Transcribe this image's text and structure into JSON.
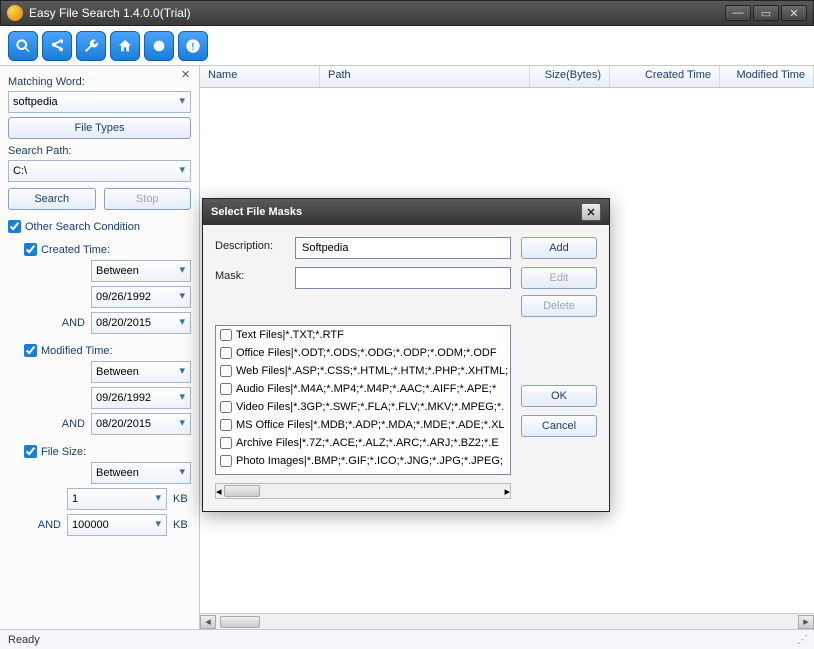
{
  "window": {
    "title": "Easy File Search 1.4.0.0(Trial)"
  },
  "toolbar_icons": [
    "search",
    "share",
    "wrench",
    "home",
    "timer",
    "alert"
  ],
  "sidebar": {
    "matching_label": "Matching Word:",
    "matching_value": "softpedia",
    "file_types_btn": "File Types",
    "search_path_label": "Search Path:",
    "search_path_value": "C:\\",
    "search_btn": "Search",
    "stop_btn": "Stop",
    "other_cond": "Other Search Condition",
    "created": {
      "label": "Created Time:",
      "mode": "Between",
      "from": "09/26/1992",
      "and": "AND",
      "to": "08/20/2015"
    },
    "modified": {
      "label": "Modified Time:",
      "mode": "Between",
      "from": "09/26/1992",
      "and": "AND",
      "to": "08/20/2015"
    },
    "size": {
      "label": "File Size:",
      "mode": "Between",
      "from": "1",
      "and": "AND",
      "to": "100000",
      "unit": "KB"
    }
  },
  "columns": [
    "Name",
    "Path",
    "Size(Bytes)",
    "Created Time",
    "Modified Time"
  ],
  "status": "Ready",
  "modal": {
    "title": "Select File Masks",
    "desc_label": "Description:",
    "desc_value": "Softpedia",
    "mask_label": "Mask:",
    "mask_value": "",
    "add_btn": "Add",
    "edit_btn": "Edit",
    "delete_btn": "Delete",
    "ok_btn": "OK",
    "cancel_btn": "Cancel",
    "masks": [
      "Text Files|*.TXT;*.RTF",
      "Office Files|*.ODT;*.ODS;*.ODG;*.ODP;*.ODM;*.ODF",
      "Web Files|*.ASP;*.CSS;*.HTML;*.HTM;*.PHP;*.XHTML;",
      "Audio Files|*.M4A;*.MP4;*.M4P;*.AAC;*.AIFF;*.APE;*",
      "Video Files|*.3GP;*.SWF;*.FLA;*.FLV;*.MKV;*.MPEG;*.",
      "MS Office Files|*.MDB;*.ADP;*.MDA;*.MDE;*.ADE;*.XL",
      "Archive Files|*.7Z;*.ACE;*.ALZ;*.ARC;*.ARJ;*.BZ2;*.E",
      "Photo Images|*.BMP;*.GIF;*.ICO;*.JNG;*.JPG;*.JPEG;"
    ]
  }
}
